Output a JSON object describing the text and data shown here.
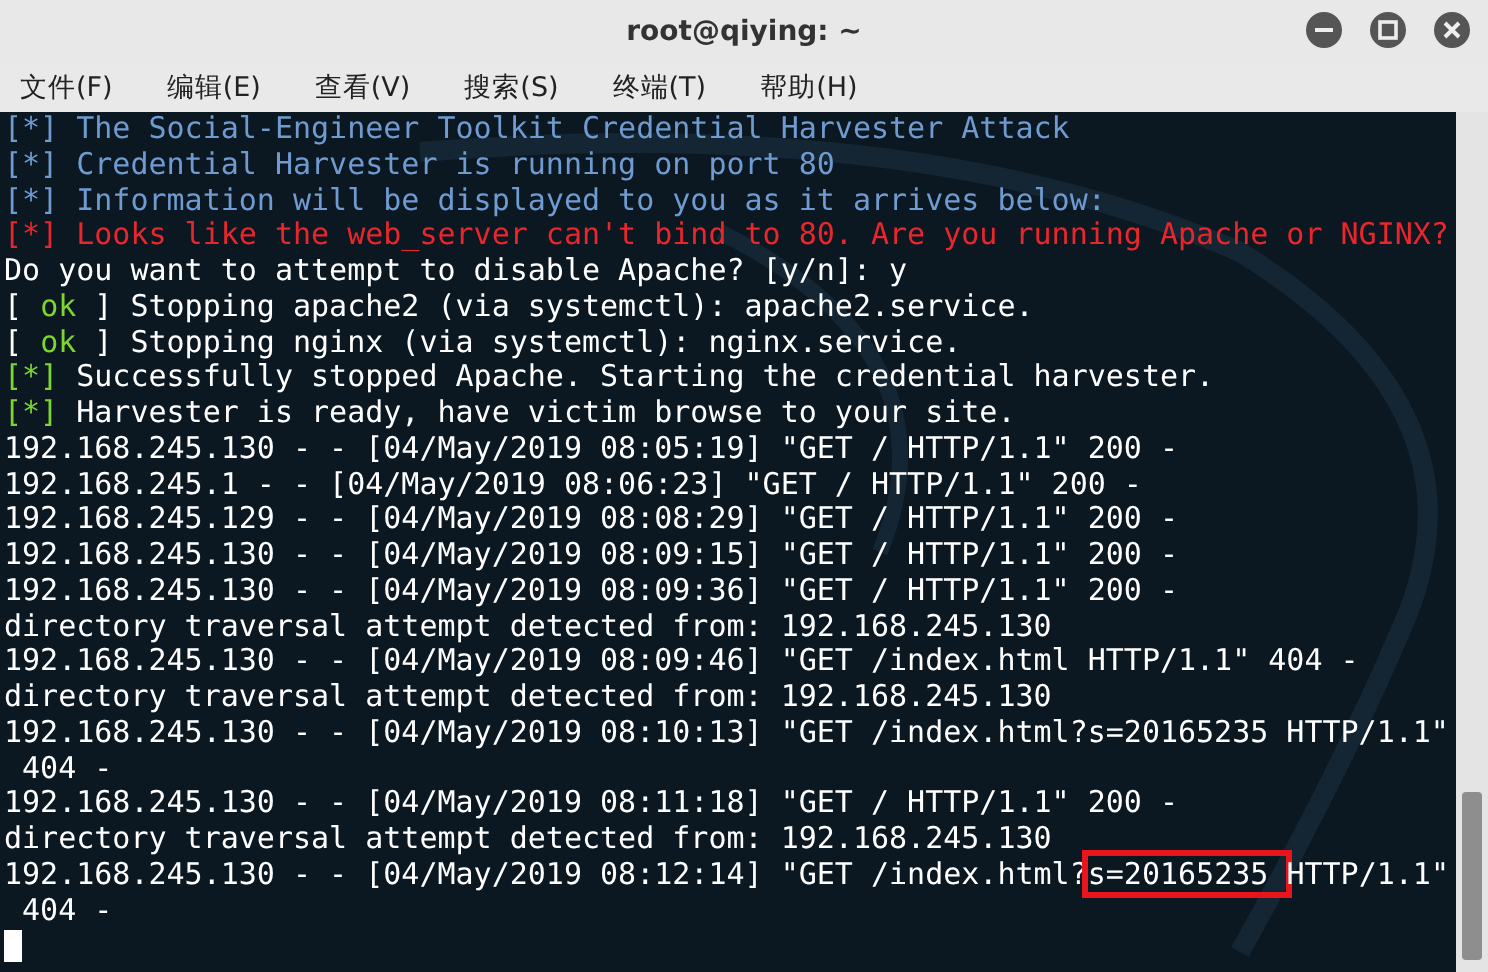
{
  "window": {
    "title": "root@qiying: ~"
  },
  "menu": [
    "文件(F)",
    "编辑(E)",
    "查看(V)",
    "搜索(S)",
    "终端(T)",
    "帮助(H)"
  ],
  "terminal": {
    "lines": [
      {
        "segments": [
          {
            "text": "[*] The Social-Engineer Toolkit Credential Harvester Attack",
            "color": "#6f9bd1"
          }
        ]
      },
      {
        "segments": [
          {
            "text": "[*] Credential Harvester is running on port 80",
            "color": "#6f9bd1"
          }
        ]
      },
      {
        "segments": [
          {
            "text": "[*] Information will be displayed to you as it arrives below:",
            "color": "#6f9bd1"
          }
        ]
      },
      {
        "segments": [
          {
            "text": "[*] Looks like the web_server can't bind to 80. Are you running Apache or NGINX?",
            "color": "#e8262b"
          }
        ]
      },
      {
        "segments": [
          {
            "text": "Do you want to attempt to disable Apache? [y/n]: y",
            "color": "#ffffff"
          }
        ]
      },
      {
        "segments": [
          {
            "text": "[ ",
            "color": "#ffffff"
          },
          {
            "text": "ok",
            "color": "#7bd62e"
          },
          {
            "text": " ] Stopping apache2 (via systemctl): apache2.service.",
            "color": "#ffffff"
          }
        ]
      },
      {
        "segments": [
          {
            "text": "[ ",
            "color": "#ffffff"
          },
          {
            "text": "ok",
            "color": "#7bd62e"
          },
          {
            "text": " ] Stopping nginx (via systemctl): nginx.service.",
            "color": "#ffffff"
          }
        ]
      },
      {
        "segments": [
          {
            "text": "[*]",
            "color": "#7bd62e"
          },
          {
            "text": " Successfully stopped Apache. Starting the credential harvester.",
            "color": "#ffffff"
          }
        ]
      },
      {
        "segments": [
          {
            "text": "[*]",
            "color": "#7bd62e"
          },
          {
            "text": " Harvester is ready, have victim browse to your site.",
            "color": "#ffffff"
          }
        ]
      },
      {
        "segments": [
          {
            "text": "192.168.245.130 - - [04/May/2019 08:05:19] \"GET / HTTP/1.1\" 200 -",
            "color": "#ffffff"
          }
        ]
      },
      {
        "segments": [
          {
            "text": "192.168.245.1 - - [04/May/2019 08:06:23] \"GET / HTTP/1.1\" 200 -",
            "color": "#ffffff"
          }
        ]
      },
      {
        "segments": [
          {
            "text": "192.168.245.129 - - [04/May/2019 08:08:29] \"GET / HTTP/1.1\" 200 -",
            "color": "#ffffff"
          }
        ]
      },
      {
        "segments": [
          {
            "text": "192.168.245.130 - - [04/May/2019 08:09:15] \"GET / HTTP/1.1\" 200 -",
            "color": "#ffffff"
          }
        ]
      },
      {
        "segments": [
          {
            "text": "192.168.245.130 - - [04/May/2019 08:09:36] \"GET / HTTP/1.1\" 200 -",
            "color": "#ffffff"
          }
        ]
      },
      {
        "segments": [
          {
            "text": "directory traversal attempt detected from: 192.168.245.130",
            "color": "#ffffff"
          }
        ]
      },
      {
        "segments": [
          {
            "text": "192.168.245.130 - - [04/May/2019 08:09:46] \"GET /index.html HTTP/1.1\" 404 -",
            "color": "#ffffff"
          }
        ]
      },
      {
        "segments": [
          {
            "text": "directory traversal attempt detected from: 192.168.245.130",
            "color": "#ffffff"
          }
        ]
      },
      {
        "segments": [
          {
            "text": "192.168.245.130 - - [04/May/2019 08:10:13] \"GET /index.html?s=20165235 HTTP/1.1\"",
            "color": "#ffffff"
          }
        ]
      },
      {
        "segments": [
          {
            "text": " 404 -",
            "color": "#ffffff"
          }
        ]
      },
      {
        "segments": [
          {
            "text": "192.168.245.130 - - [04/May/2019 08:11:18] \"GET / HTTP/1.1\" 200 -",
            "color": "#ffffff"
          }
        ]
      },
      {
        "segments": [
          {
            "text": "directory traversal attempt detected from: 192.168.245.130",
            "color": "#ffffff"
          }
        ]
      },
      {
        "segments": [
          {
            "text": "192.168.245.130 - - [04/May/2019 08:12:14] \"GET /index.html?",
            "color": "#ffffff"
          },
          {
            "text": "s=20165235 ",
            "color": "#ffffff",
            "boxed": true
          },
          {
            "text": "HTTP/1.1\"",
            "color": "#ffffff"
          }
        ]
      },
      {
        "segments": [
          {
            "text": " 404 -",
            "color": "#ffffff"
          }
        ]
      }
    ]
  }
}
